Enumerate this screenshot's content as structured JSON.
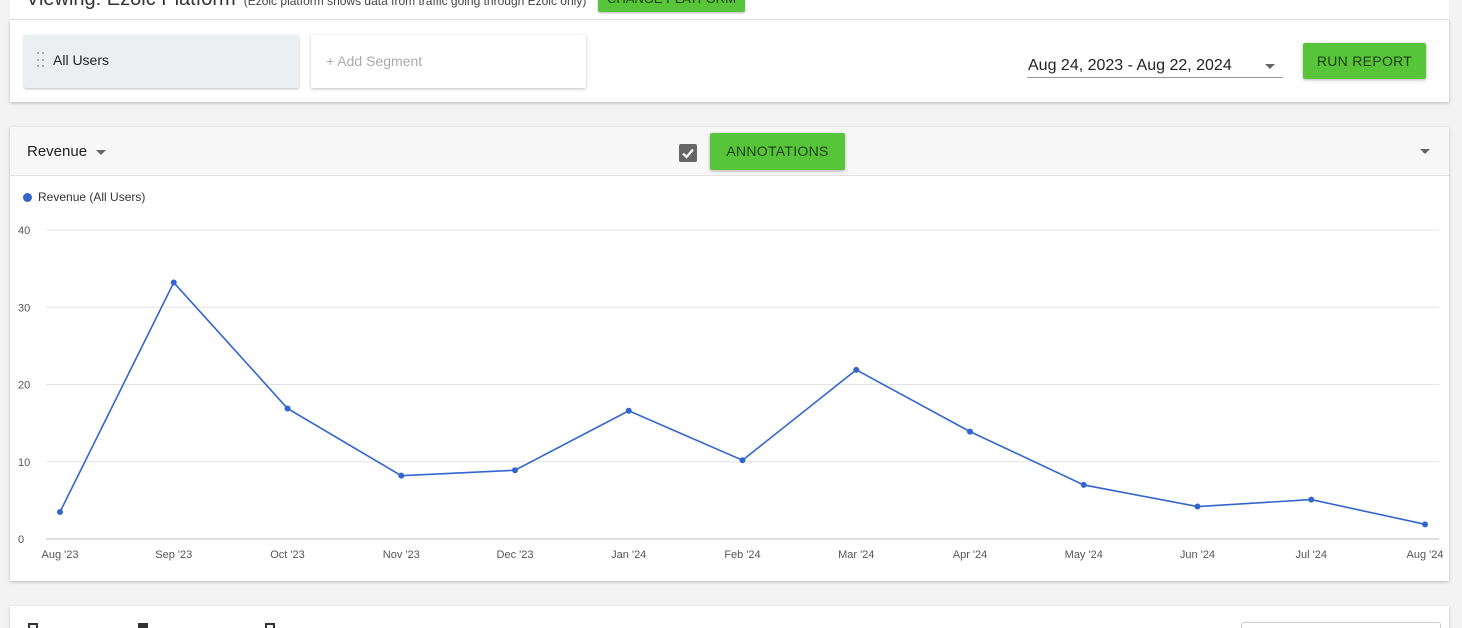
{
  "top_bar": {
    "viewing": "Viewing: Ezoic Platform",
    "note": "(Ezoic platform shows data from traffic going through Ezoic only)",
    "change_platform": "CHANGE PLATFORM"
  },
  "segments": {
    "active": "All Users",
    "add_placeholder": "+ Add Segment",
    "date_range": "Aug 24, 2023 - Aug 22, 2024",
    "run_report": "RUN REPORT"
  },
  "chart_header": {
    "metric": "Revenue",
    "annotations_checked": true,
    "annotations_label": "ANNOTATIONS"
  },
  "chart_data": {
    "type": "line",
    "categories": [
      "Aug '23",
      "Sep '23",
      "Oct '23",
      "Nov '23",
      "Dec '23",
      "Jan '24",
      "Feb '24",
      "Mar '24",
      "Apr '24",
      "May '24",
      "Jun '24",
      "Jul '24",
      "Aug '24"
    ],
    "series": [
      {
        "name": "Revenue (All Users)",
        "color": "#3366cc",
        "values": [
          3.5,
          33.2,
          16.9,
          8.2,
          8.9,
          16.6,
          10.2,
          21.9,
          13.9,
          7.0,
          4.2,
          5.1,
          1.9
        ]
      }
    ],
    "y_ticks": [
      "0",
      "10",
      "20",
      "30",
      "40"
    ],
    "ylim": [
      0,
      40
    ],
    "grid": true,
    "legend": "top-left",
    "title": "",
    "xlabel": "",
    "ylabel": ""
  }
}
